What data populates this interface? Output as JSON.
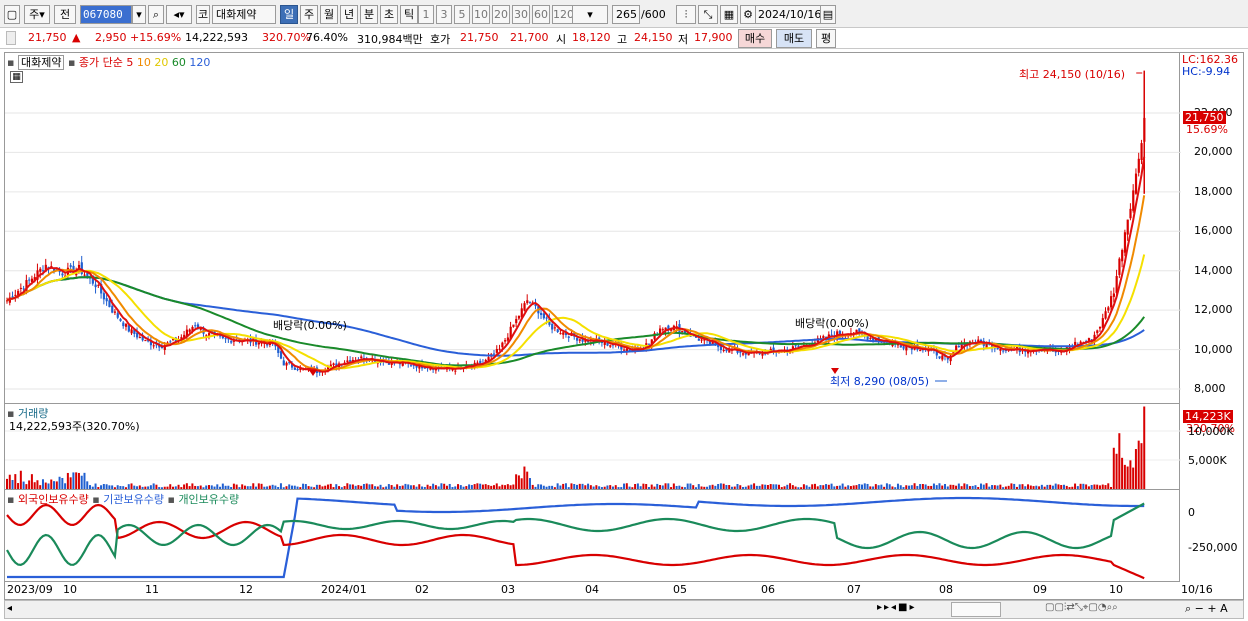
{
  "toolbar": {
    "type_label": "주",
    "prev_label": "전",
    "code": "067080",
    "company_prefix": "코",
    "company": "대화제약",
    "periods": [
      "일",
      "주",
      "월",
      "년",
      "분",
      "초",
      "틱"
    ],
    "active_period": "일",
    "intervals": [
      "1",
      "3",
      "5",
      "10",
      "20",
      "30",
      "60",
      "120"
    ],
    "count": "265",
    "total": "/600",
    "date": "2024/10/16"
  },
  "quote": {
    "price": "21,750",
    "arrow": "▲",
    "change": "2,950",
    "rate": "+15.69%",
    "volume": "14,222,593",
    "vol_ratio": "320.70%",
    "turnover": "76.40%",
    "amount": "310,984백만",
    "ask_label": "호가",
    "ask": "21,750",
    "bid": "21,700",
    "open_label": "시",
    "open": "18,120",
    "high_label": "고",
    "high": "24,150",
    "low_label": "저",
    "low": "17,900",
    "buy_label": "매수",
    "sell_label": "매도",
    "eval_label": "평"
  },
  "main_legend": {
    "name": "대화제약",
    "series": "종가 단순 5",
    "ma": [
      "10",
      "20",
      "60",
      "120"
    ]
  },
  "annotations": {
    "dividend1": "배당락(0.00%)",
    "dividend2": "배당락(0.00%)",
    "high": "최고 24,150 (10/16)",
    "low": "최저 8,290 (08/05)",
    "lc": "LC:162.36",
    "hc": "HC:-9.94",
    "last_price": "21,750",
    "last_rate": "15.69%"
  },
  "volume_panel": {
    "title": "거래량",
    "value": "14,222,593주(320.70%)",
    "last": "14,223K",
    "last_rate": "320.70%"
  },
  "holding_panel": {
    "foreign": "외국인보유수량",
    "inst": "기관보유수량",
    "indiv": "개인보유수량"
  },
  "x_labels": [
    "2023/09",
    "10",
    "11",
    "12",
    "2024/01",
    "02",
    "03",
    "04",
    "05",
    "06",
    "07",
    "08",
    "09",
    "10",
    "10/16"
  ],
  "price_ticks": [
    "22,000",
    "20,000",
    "18,000",
    "16,000",
    "14,000",
    "12,000",
    "10,000",
    "8,000"
  ],
  "volume_ticks": [
    "10,000K",
    "5,000K"
  ],
  "holding_ticks": [
    "0",
    "-250,000"
  ],
  "colors": {
    "up": "#d80000",
    "down": "#1f5fd0",
    "ma5": "#e01010",
    "ma10": "#f08a00",
    "ma20": "#f5e000",
    "ma60": "#1a8a2a",
    "ma120": "#2a5fd8"
  },
  "chart_data": {
    "type": "candlestick",
    "x_range": [
      "2023/09",
      "2024/10/16"
    ],
    "ylim": [
      8000,
      22000
    ],
    "close_path": [
      [
        0,
        12500
      ],
      [
        8,
        13500
      ],
      [
        14,
        14300
      ],
      [
        20,
        13900
      ],
      [
        26,
        14100
      ],
      [
        32,
        13300
      ],
      [
        38,
        12000
      ],
      [
        44,
        11000
      ],
      [
        50,
        10400
      ],
      [
        56,
        10200
      ],
      [
        62,
        10500
      ],
      [
        68,
        11300
      ],
      [
        72,
        10800
      ],
      [
        78,
        10500
      ],
      [
        84,
        10500
      ],
      [
        90,
        10400
      ],
      [
        96,
        10300
      ],
      [
        100,
        9300
      ],
      [
        106,
        9000
      ],
      [
        112,
        8900
      ],
      [
        118,
        9200
      ],
      [
        124,
        9500
      ],
      [
        130,
        9600
      ],
      [
        136,
        9400
      ],
      [
        142,
        9300
      ],
      [
        148,
        9200
      ],
      [
        154,
        9100
      ],
      [
        160,
        9000
      ],
      [
        166,
        9100
      ],
      [
        172,
        9300
      ],
      [
        178,
        10000
      ],
      [
        184,
        11500
      ],
      [
        188,
        12500
      ],
      [
        192,
        12000
      ],
      [
        196,
        11200
      ],
      [
        202,
        10800
      ],
      [
        208,
        10500
      ],
      [
        214,
        10400
      ],
      [
        220,
        10200
      ],
      [
        226,
        10000
      ],
      [
        232,
        10300
      ],
      [
        236,
        11100
      ],
      [
        240,
        11200
      ],
      [
        246,
        10800
      ],
      [
        252,
        10400
      ],
      [
        258,
        10100
      ],
      [
        264,
        9900
      ],
      [
        270,
        9800
      ],
      [
        276,
        9900
      ],
      [
        282,
        10000
      ],
      [
        288,
        10200
      ],
      [
        294,
        10500
      ],
      [
        300,
        10800
      ],
      [
        306,
        10900
      ],
      [
        312,
        10600
      ],
      [
        318,
        10400
      ],
      [
        324,
        10200
      ],
      [
        330,
        10100
      ],
      [
        336,
        9800
      ],
      [
        340,
        9400
      ],
      [
        344,
        10300
      ],
      [
        350,
        10400
      ],
      [
        356,
        10200
      ],
      [
        362,
        10000
      ],
      [
        368,
        10000
      ],
      [
        374,
        10100
      ],
      [
        380,
        9800
      ],
      [
        386,
        10300
      ],
      [
        392,
        10500
      ],
      [
        396,
        11500
      ],
      [
        400,
        13000
      ],
      [
        404,
        16000
      ],
      [
        408,
        18800
      ],
      [
        411,
        21750
      ]
    ],
    "high": 24150,
    "low": 8290
  }
}
